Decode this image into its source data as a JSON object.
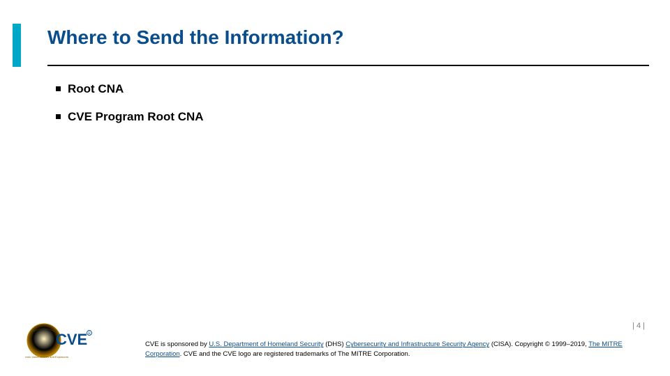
{
  "title": "Where to Send the Information?",
  "bullets": [
    "Root CNA",
    "CVE Program Root CNA"
  ],
  "page_number": "| 4 |",
  "footer": {
    "prefix": "CVE is sponsored by ",
    "link1": "U.S. Department of Homeland Security",
    "mid1": " (DHS) ",
    "link2": "Cybersecurity and Infrastructure Security Agency",
    "mid2": " (CISA). Copyright © 1999–2019, ",
    "link3": "The MITRE Corporation",
    "suffix": ". CVE and the CVE logo are registered trademarks of The MITRE Corporation."
  },
  "logo_alt": "CVE"
}
